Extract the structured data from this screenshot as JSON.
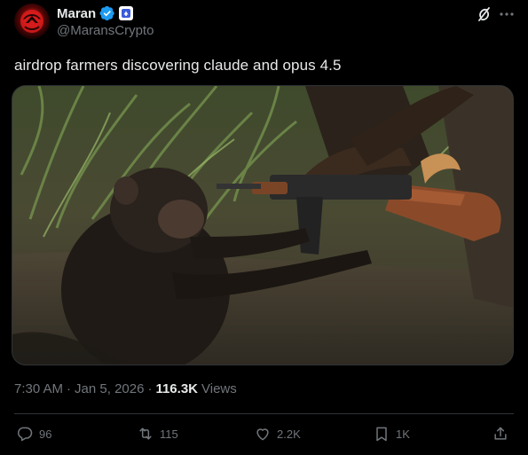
{
  "author": {
    "display_name": "Maran",
    "handle": "@MaransCrypto"
  },
  "tweet": {
    "text": "airdrop farmers discovering claude and opus 4.5"
  },
  "meta": {
    "time": "7:30 AM",
    "separator1": "·",
    "date": "Jan 5, 2026",
    "separator2": "·",
    "views_count": "116.3K",
    "views_label": "Views"
  },
  "actions": {
    "reply_count": "96",
    "retweet_count": "115",
    "like_count": "2.2K",
    "bookmark_count": "1K"
  },
  "colors": {
    "background": "#000000",
    "text_primary": "#e7e9ea",
    "text_secondary": "#71767b",
    "border": "#2f3336",
    "verified_blue": "#1d9bf0"
  },
  "icons": {
    "verified": "verified-badge-icon",
    "affiliate": "affiliate-badge-icon",
    "grok": "grok-icon",
    "more": "more-icon",
    "reply": "reply-icon",
    "retweet": "retweet-icon",
    "like": "like-icon",
    "bookmark": "bookmark-icon",
    "share": "share-icon"
  }
}
